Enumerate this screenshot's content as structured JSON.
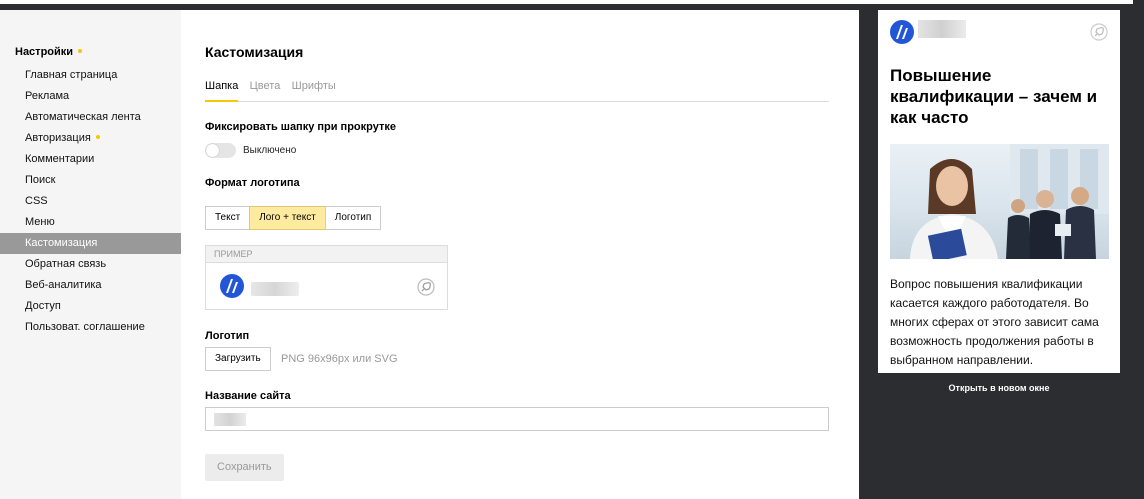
{
  "sidebar": {
    "title": "Настройки",
    "items": [
      {
        "label": "Главная страница"
      },
      {
        "label": "Реклама"
      },
      {
        "label": "Автоматическая лента"
      },
      {
        "label": "Авторизация"
      },
      {
        "label": "Комментарии"
      },
      {
        "label": "Поиск"
      },
      {
        "label": "CSS"
      },
      {
        "label": "Меню"
      },
      {
        "label": "Кастомизация"
      },
      {
        "label": "Обратная связь"
      },
      {
        "label": "Веб-аналитика"
      },
      {
        "label": "Доступ"
      },
      {
        "label": "Пользоват. соглашение"
      }
    ],
    "active_index": 8
  },
  "main": {
    "title": "Кастомизация",
    "tabs": [
      {
        "label": "Шапка"
      },
      {
        "label": "Цвета"
      },
      {
        "label": "Шрифты"
      }
    ],
    "fixed_header": {
      "label": "Фиксировать шапку при прокрутке",
      "state_label": "Выключено",
      "enabled": false
    },
    "logo_format": {
      "label": "Формат логотипа",
      "options": [
        "Текст",
        "Лого + текст",
        "Логотип"
      ],
      "selected": "Лого + текст"
    },
    "example": {
      "label": "ПРИМЕР"
    },
    "logo": {
      "label": "Логотип",
      "upload_label": "Загрузить",
      "hint": "PNG 96x96px или SVG"
    },
    "site_name": {
      "label": "Название сайта"
    },
    "save_label": "Сохранить"
  },
  "preview": {
    "title": "Повышение квалификации – зачем и как часто",
    "text": "Вопрос повышения квалификации касается каждого работодателя. Во многих сферах от этого зависит сама возможность продолжения работы в выбранном направлении.",
    "open_link": "Открыть в новом окне"
  },
  "colors": {
    "accent": "#f5c800",
    "logo_blue": "#2356d6",
    "sidebar_active": "#999999",
    "dark_bg": "#2b2d31"
  }
}
